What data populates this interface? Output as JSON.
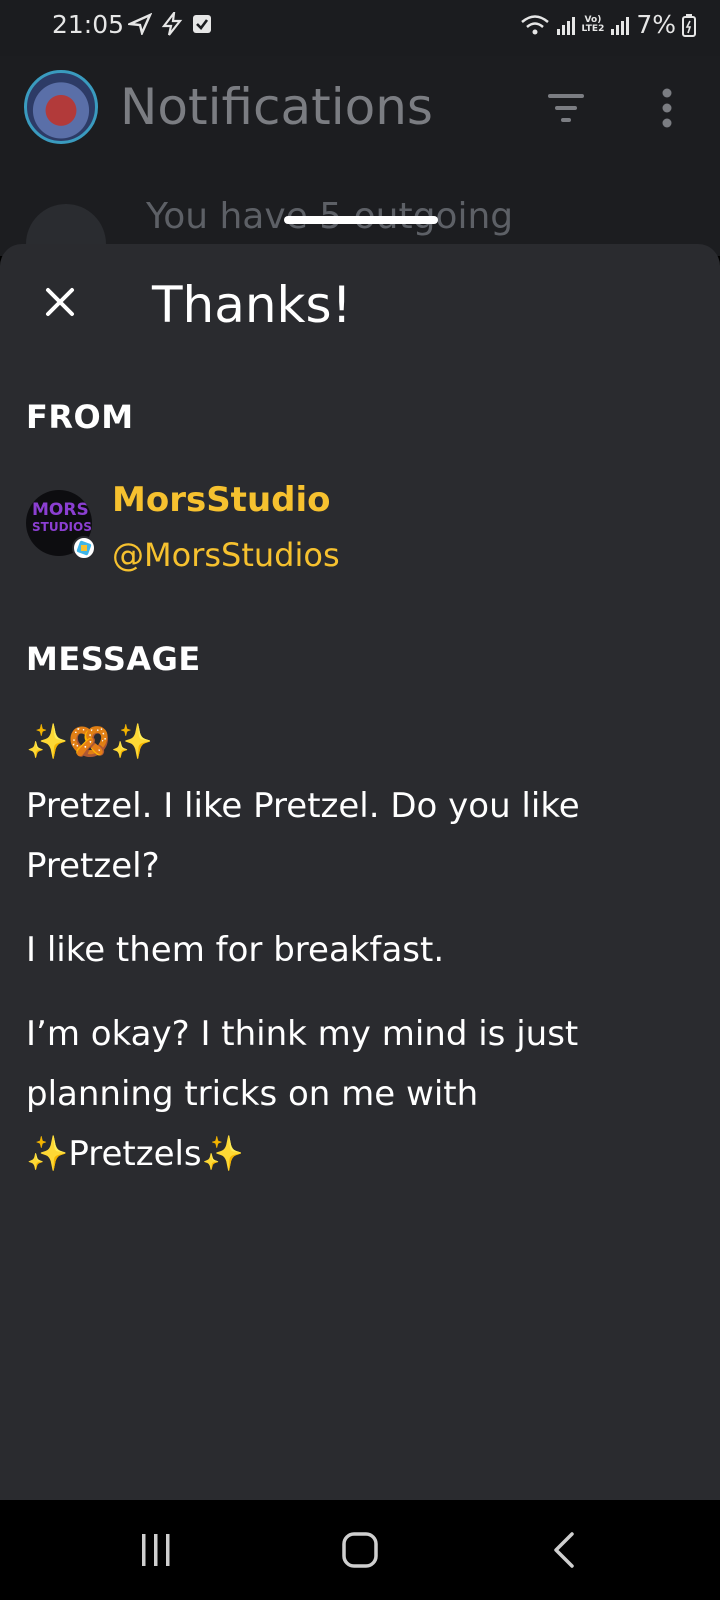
{
  "status_bar": {
    "time": "21:05",
    "battery": "7%",
    "network": "LTE2"
  },
  "background": {
    "title": "Notifications",
    "row_text": "You have 5 outgoing"
  },
  "sheet": {
    "title": "Thanks!",
    "from_label": "FROM",
    "sender_name": "MorsStudio",
    "sender_handle": "@MorsStudios",
    "sender_avatar_line1": "MORS",
    "sender_avatar_line2": "STUDIOS",
    "message_label": "MESSAGE",
    "message_emoji": "✨🥨✨",
    "paragraphs": [
      "Pretzel. I like Pretzel. Do you like Pretzel?",
      "I like them for breakfast.",
      "I’m okay? I think my mind is just planning tricks on me with ✨Pretzels✨"
    ]
  },
  "colors": {
    "accent": "#f6c12f",
    "sheet_bg": "#2a2b2f",
    "page_bg": "#1c1d20"
  }
}
